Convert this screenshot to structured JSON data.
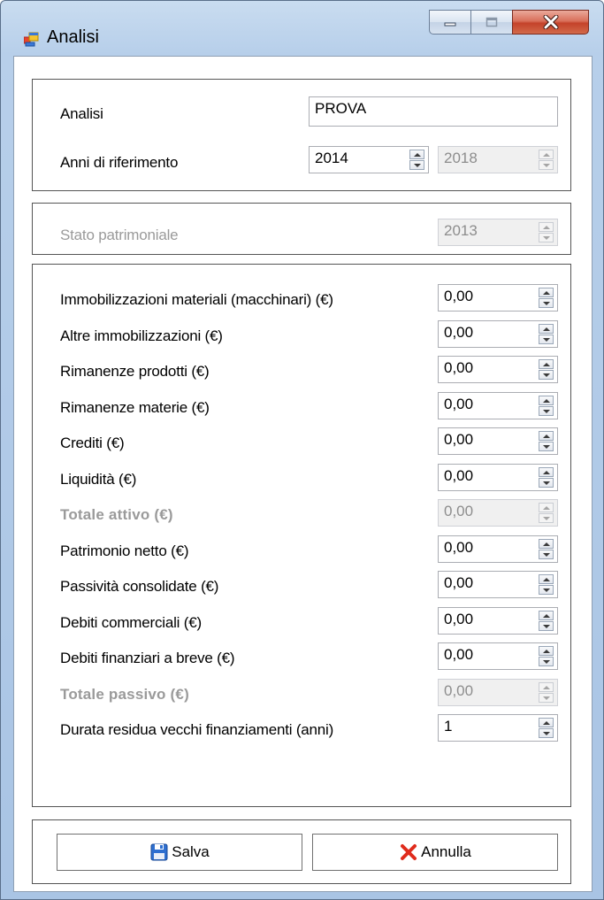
{
  "window": {
    "title": "Analisi"
  },
  "header": {
    "analisi_label": "Analisi",
    "analisi_value": "PROVA",
    "anni_label": "Anni di riferimento",
    "anno_inizio": "2014",
    "anno_fine": "2018"
  },
  "stato": {
    "label": "Stato patrimoniale",
    "anno": "2013"
  },
  "fields": [
    {
      "label": "Immobilizzazioni materiali (macchinari) (€)",
      "value": "0,00"
    },
    {
      "label": "Altre immobilizzazioni (€)",
      "value": "0,00"
    },
    {
      "label": "Rimanenze prodotti (€)",
      "value": "0,00"
    },
    {
      "label": "Rimanenze materie (€)",
      "value": "0,00"
    },
    {
      "label": "Crediti (€)",
      "value": "0,00"
    },
    {
      "label": "Liquidità (€)",
      "value": "0,00"
    },
    {
      "label": "Totale attivo (€)",
      "value": "0,00"
    },
    {
      "label": "Patrimonio netto (€)",
      "value": "0,00"
    },
    {
      "label": "Passività consolidate (€)",
      "value": "0,00"
    },
    {
      "label": "Debiti commerciali (€)",
      "value": "0,00"
    },
    {
      "label": "Debiti finanziari a breve (€)",
      "value": "0,00"
    },
    {
      "label": "Totale passivo (€)",
      "value": "0,00"
    },
    {
      "label": "Durata residua vecchi finanziamenti (anni)",
      "value": "1"
    }
  ],
  "buttons": {
    "save_label": "Salva",
    "cancel_label": "Annulla"
  },
  "icons": {
    "app": "app-window-icon",
    "save": "floppy-disk-icon",
    "cancel": "red-x-icon"
  }
}
